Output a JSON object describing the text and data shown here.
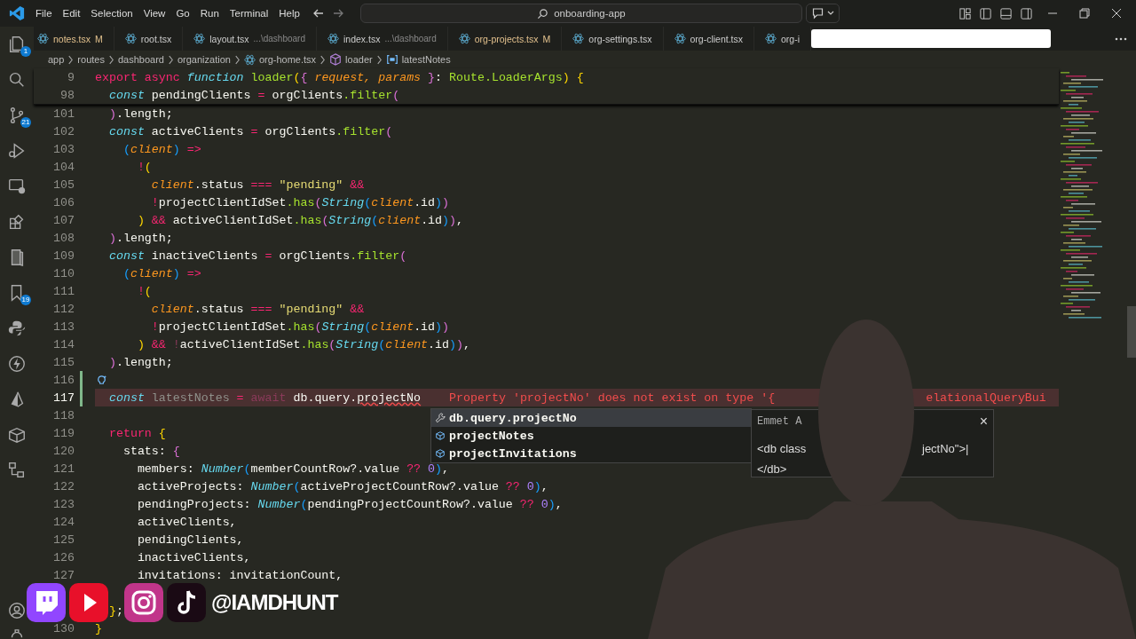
{
  "menu": [
    "File",
    "Edit",
    "Selection",
    "View",
    "Go",
    "Run",
    "Terminal",
    "Help"
  ],
  "search": {
    "value": "onboarding-app"
  },
  "activity_bar": {
    "explorer_badge": "1",
    "source_control_badge": "21",
    "bookmarks_badge": "19"
  },
  "tabs": [
    {
      "label": "notes.tsx",
      "git_status": "M"
    },
    {
      "label": "root.tsx"
    },
    {
      "label": "layout.tsx",
      "description": "...\\dashboard"
    },
    {
      "label": "index.tsx",
      "description": "...\\dashboard"
    },
    {
      "label": "org-projects.tsx",
      "git_status": "M"
    },
    {
      "label": "org-settings.tsx"
    },
    {
      "label": "org-client.tsx"
    },
    {
      "label": "org-i"
    }
  ],
  "breadcrumbs": [
    {
      "label": "app",
      "kind": "folder"
    },
    {
      "label": "routes",
      "kind": "folder"
    },
    {
      "label": "dashboard",
      "kind": "folder"
    },
    {
      "label": "organization",
      "kind": "folder"
    },
    {
      "label": "org-home.tsx",
      "kind": "file"
    },
    {
      "label": "loader",
      "kind": "method"
    },
    {
      "label": "latestNotes",
      "kind": "variable"
    }
  ],
  "sticky_lines": [
    {
      "n": "9",
      "code": [
        {
          "kind": "kw",
          "text": "export async"
        },
        {
          "kind": "storage",
          "text": " function"
        },
        {
          "kind": "fn",
          "text": " loader"
        },
        {
          "kind": "br1",
          "text": "("
        },
        {
          "kind": "br2",
          "text": "{"
        },
        {
          "kind": "param",
          "text": " request, params "
        },
        {
          "kind": "br2",
          "text": "}"
        },
        {
          "kind": "plain",
          "text": ": "
        },
        {
          "kind": "fn",
          "text": "Route.LoaderArgs"
        },
        {
          "kind": "br1",
          "text": ")"
        },
        {
          "kind": "br1",
          "text": " {"
        }
      ]
    },
    {
      "n": "98",
      "code": [
        {
          "kind": "storage",
          "text": "  const"
        },
        {
          "kind": "plain",
          "text": " pendingClients "
        },
        {
          "kind": "op",
          "text": "="
        },
        {
          "kind": "plain",
          "text": " orgClients"
        },
        {
          "kind": "fn",
          "text": ".filter"
        },
        {
          "kind": "br2",
          "text": "("
        }
      ]
    }
  ],
  "lines": [
    {
      "n": "101",
      "current": false,
      "changed": false,
      "lightbulb": false,
      "code": [
        {
          "kind": "br2",
          "text": "  )"
        },
        {
          "kind": "plain",
          "text": ".length;"
        }
      ]
    },
    {
      "n": "102",
      "current": false,
      "changed": false,
      "lightbulb": false,
      "code": [
        {
          "kind": "storage",
          "text": "  const"
        },
        {
          "kind": "plain",
          "text": " activeClients "
        },
        {
          "kind": "op",
          "text": "="
        },
        {
          "kind": "plain",
          "text": " orgClients"
        },
        {
          "kind": "fn",
          "text": ".filter"
        },
        {
          "kind": "br2",
          "text": "("
        }
      ]
    },
    {
      "n": "103",
      "current": false,
      "changed": false,
      "lightbulb": false,
      "code": [
        {
          "kind": "br3",
          "text": "    ("
        },
        {
          "kind": "param",
          "text": "client"
        },
        {
          "kind": "br3",
          "text": ")"
        },
        {
          "kind": "op",
          "text": " =>"
        }
      ]
    },
    {
      "n": "104",
      "current": false,
      "changed": false,
      "lightbulb": false,
      "code": [
        {
          "kind": "op",
          "text": "      !"
        },
        {
          "kind": "br1",
          "text": "("
        }
      ]
    },
    {
      "n": "105",
      "current": false,
      "changed": false,
      "lightbulb": false,
      "code": [
        {
          "kind": "param",
          "text": "        client"
        },
        {
          "kind": "plain",
          "text": ".status "
        },
        {
          "kind": "op",
          "text": "==="
        },
        {
          "kind": "str",
          "text": " \"pending\""
        },
        {
          "kind": "op",
          "text": " &&"
        }
      ]
    },
    {
      "n": "106",
      "current": false,
      "changed": false,
      "lightbulb": false,
      "code": [
        {
          "kind": "op",
          "text": "        !"
        },
        {
          "kind": "plain",
          "text": "projectClientIdSet"
        },
        {
          "kind": "fn",
          "text": ".has"
        },
        {
          "kind": "br2",
          "text": "("
        },
        {
          "kind": "type",
          "text": "String"
        },
        {
          "kind": "br3",
          "text": "("
        },
        {
          "kind": "param",
          "text": "client"
        },
        {
          "kind": "plain",
          "text": ".id"
        },
        {
          "kind": "br3",
          "text": ")"
        },
        {
          "kind": "br2",
          "text": ")"
        }
      ]
    },
    {
      "n": "107",
      "current": false,
      "changed": false,
      "lightbulb": false,
      "code": [
        {
          "kind": "br1",
          "text": "      )"
        },
        {
          "kind": "op",
          "text": " &&"
        },
        {
          "kind": "plain",
          "text": " activeClientIdSet"
        },
        {
          "kind": "fn",
          "text": ".has"
        },
        {
          "kind": "br2",
          "text": "("
        },
        {
          "kind": "type",
          "text": "String"
        },
        {
          "kind": "br3",
          "text": "("
        },
        {
          "kind": "param",
          "text": "client"
        },
        {
          "kind": "plain",
          "text": ".id"
        },
        {
          "kind": "br3",
          "text": ")"
        },
        {
          "kind": "br2",
          "text": ")"
        },
        {
          "kind": "plain",
          "text": ","
        }
      ]
    },
    {
      "n": "108",
      "current": false,
      "changed": false,
      "lightbulb": false,
      "code": [
        {
          "kind": "br2",
          "text": "  )"
        },
        {
          "kind": "plain",
          "text": ".length;"
        }
      ]
    },
    {
      "n": "109",
      "current": false,
      "changed": false,
      "lightbulb": false,
      "code": [
        {
          "kind": "storage",
          "text": "  const"
        },
        {
          "kind": "plain",
          "text": " inactiveClients "
        },
        {
          "kind": "op",
          "text": "="
        },
        {
          "kind": "plain",
          "text": " orgClients"
        },
        {
          "kind": "fn",
          "text": ".filter"
        },
        {
          "kind": "br2",
          "text": "("
        }
      ]
    },
    {
      "n": "110",
      "current": false,
      "changed": false,
      "lightbulb": false,
      "code": [
        {
          "kind": "br3",
          "text": "    ("
        },
        {
          "kind": "param",
          "text": "client"
        },
        {
          "kind": "br3",
          "text": ")"
        },
        {
          "kind": "op",
          "text": " =>"
        }
      ]
    },
    {
      "n": "111",
      "current": false,
      "changed": false,
      "lightbulb": false,
      "code": [
        {
          "kind": "op",
          "text": "      !"
        },
        {
          "kind": "br1",
          "text": "("
        }
      ]
    },
    {
      "n": "112",
      "current": false,
      "changed": false,
      "lightbulb": false,
      "code": [
        {
          "kind": "param",
          "text": "        client"
        },
        {
          "kind": "plain",
          "text": ".status "
        },
        {
          "kind": "op",
          "text": "==="
        },
        {
          "kind": "str",
          "text": " \"pending\""
        },
        {
          "kind": "op",
          "text": " &&"
        }
      ]
    },
    {
      "n": "113",
      "current": false,
      "changed": false,
      "lightbulb": false,
      "code": [
        {
          "kind": "op",
          "text": "        !"
        },
        {
          "kind": "plain",
          "text": "projectClientIdSet"
        },
        {
          "kind": "fn",
          "text": ".has"
        },
        {
          "kind": "br2",
          "text": "("
        },
        {
          "kind": "type",
          "text": "String"
        },
        {
          "kind": "br3",
          "text": "("
        },
        {
          "kind": "param",
          "text": "client"
        },
        {
          "kind": "plain",
          "text": ".id"
        },
        {
          "kind": "br3",
          "text": ")"
        },
        {
          "kind": "br2",
          "text": ")"
        }
      ]
    },
    {
      "n": "114",
      "current": false,
      "changed": false,
      "lightbulb": false,
      "code": [
        {
          "kind": "br1",
          "text": "      )"
        },
        {
          "kind": "op",
          "text": " &&"
        },
        {
          "kind": "dimop",
          "text": " !"
        },
        {
          "kind": "plain",
          "text": "activeClientIdSet"
        },
        {
          "kind": "fn",
          "text": ".has"
        },
        {
          "kind": "br2",
          "text": "("
        },
        {
          "kind": "type",
          "text": "String"
        },
        {
          "kind": "br3",
          "text": "("
        },
        {
          "kind": "param",
          "text": "client"
        },
        {
          "kind": "plain",
          "text": ".id"
        },
        {
          "kind": "br3",
          "text": ")"
        },
        {
          "kind": "br2",
          "text": ")"
        },
        {
          "kind": "plain",
          "text": ","
        }
      ]
    },
    {
      "n": "115",
      "current": false,
      "changed": false,
      "lightbulb": false,
      "code": [
        {
          "kind": "br2",
          "text": "  )"
        },
        {
          "kind": "plain",
          "text": ".length;"
        }
      ]
    },
    {
      "n": "116",
      "current": false,
      "changed": true,
      "lightbulb": true
    },
    {
      "n": "117",
      "current": true,
      "changed": true,
      "lightbulb": false,
      "code": [
        {
          "kind": "storage",
          "text": "  const"
        },
        {
          "kind": "dim",
          "text": " latestNotes "
        },
        {
          "kind": "op",
          "text": "="
        },
        {
          "kind": "dimop",
          "text": " await"
        },
        {
          "kind": "plain",
          "text": " db.query."
        },
        {
          "kind": "error",
          "text": "projectNo"
        }
      ],
      "error": [
        "Property 'projectNo' does not exist on type '{",
        "elationalQueryBui"
      ]
    },
    {
      "n": "118",
      "current": false,
      "changed": false,
      "lightbulb": false
    },
    {
      "n": "119",
      "current": false,
      "changed": false,
      "lightbulb": false,
      "code": [
        {
          "kind": "kw",
          "text": "  return"
        },
        {
          "kind": "br1",
          "text": " {"
        }
      ]
    },
    {
      "n": "120",
      "current": false,
      "changed": false,
      "lightbulb": false,
      "code": [
        {
          "kind": "plain",
          "text": "    stats: "
        },
        {
          "kind": "br2",
          "text": "{"
        }
      ]
    },
    {
      "n": "121",
      "current": false,
      "changed": false,
      "lightbulb": false,
      "code": [
        {
          "kind": "plain",
          "text": "      members: "
        },
        {
          "kind": "type",
          "text": "Number"
        },
        {
          "kind": "br3",
          "text": "("
        },
        {
          "kind": "plain",
          "text": "memberCountRow?.value "
        },
        {
          "kind": "op",
          "text": "??"
        },
        {
          "kind": "num",
          "text": " 0"
        },
        {
          "kind": "br3",
          "text": ")"
        },
        {
          "kind": "plain",
          "text": ","
        }
      ]
    },
    {
      "n": "122",
      "current": false,
      "changed": false,
      "lightbulb": false,
      "code": [
        {
          "kind": "plain",
          "text": "      activeProjects: "
        },
        {
          "kind": "type",
          "text": "Number"
        },
        {
          "kind": "br3",
          "text": "("
        },
        {
          "kind": "plain",
          "text": "activeProjectCountRow?.value "
        },
        {
          "kind": "op",
          "text": "??"
        },
        {
          "kind": "num",
          "text": " 0"
        },
        {
          "kind": "br3",
          "text": ")"
        },
        {
          "kind": "plain",
          "text": ","
        }
      ]
    },
    {
      "n": "123",
      "current": false,
      "changed": false,
      "lightbulb": false,
      "code": [
        {
          "kind": "plain",
          "text": "      pendingProjects: "
        },
        {
          "kind": "type",
          "text": "Number"
        },
        {
          "kind": "br3",
          "text": "("
        },
        {
          "kind": "plain",
          "text": "pendingProjectCountRow?.value "
        },
        {
          "kind": "op",
          "text": "??"
        },
        {
          "kind": "num",
          "text": " 0"
        },
        {
          "kind": "br3",
          "text": ")"
        },
        {
          "kind": "plain",
          "text": ","
        }
      ]
    },
    {
      "n": "124",
      "current": false,
      "changed": false,
      "lightbulb": false,
      "code": [
        {
          "kind": "plain",
          "text": "      activeClients,"
        }
      ]
    },
    {
      "n": "125",
      "current": false,
      "changed": false,
      "lightbulb": false,
      "code": [
        {
          "kind": "plain",
          "text": "      pendingClients,"
        }
      ]
    },
    {
      "n": "126",
      "current": false,
      "changed": false,
      "lightbulb": false,
      "code": [
        {
          "kind": "plain",
          "text": "      inactiveClients,"
        }
      ]
    },
    {
      "n": "127",
      "current": false,
      "changed": false,
      "lightbulb": false,
      "code": [
        {
          "kind": "plain",
          "text": "      invitations: invitationCount,"
        }
      ]
    },
    {
      "changed": false,
      "lightbulb": false
    },
    {
      "changed": false,
      "lightbulb": false,
      "code": [
        {
          "kind": "br1",
          "text": "  }"
        },
        {
          "kind": "plain",
          "text": ";"
        }
      ]
    },
    {
      "n": "130",
      "current": false,
      "changed": false,
      "lightbulb": false,
      "code": [
        {
          "kind": "br1",
          "text": "}"
        }
      ]
    }
  ],
  "suggestions": [
    {
      "kind": "snippet",
      "label": "db.query.projectNo",
      "selected": true
    },
    {
      "kind": "property",
      "label": "projectNotes",
      "selected": false
    },
    {
      "kind": "property",
      "label": "projectInvitations",
      "selected": false
    }
  ],
  "emmet_popup": {
    "title": "Emmet A",
    "close": "×",
    "lines": [
      [
        "<db class",
        "jectNo\">|"
      ],
      [
        "</db>"
      ]
    ]
  },
  "overlay": {
    "handle": "@IAMDHUNT"
  }
}
